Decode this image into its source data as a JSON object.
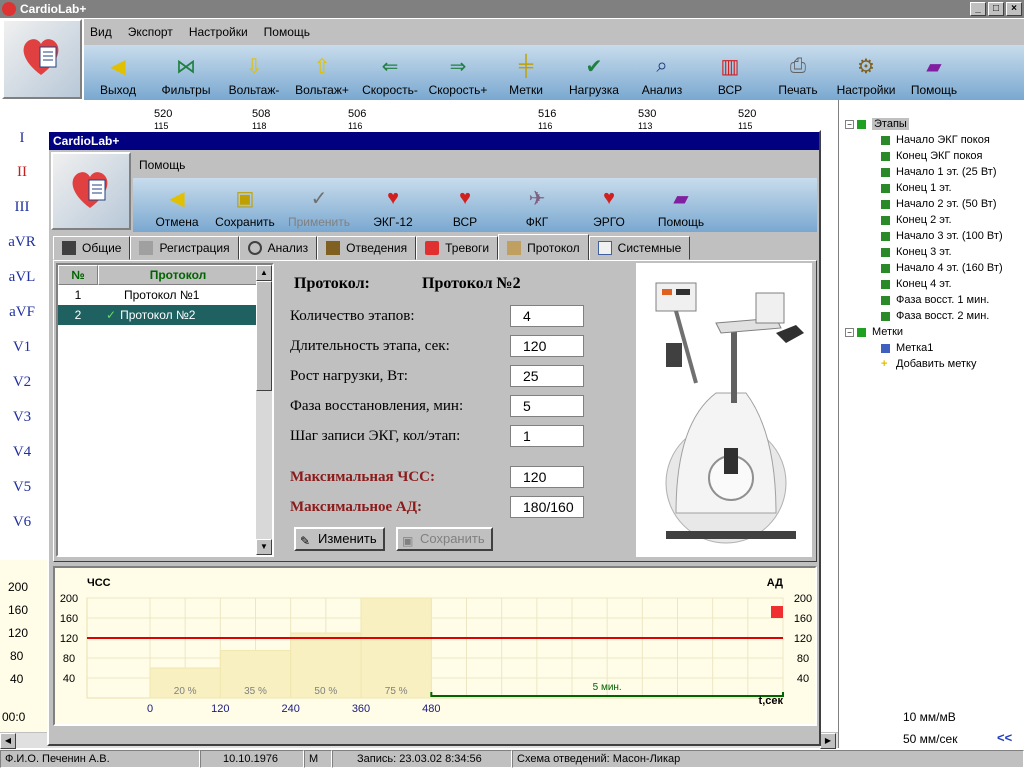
{
  "main": {
    "title": "CardioLab+",
    "menu": [
      "Вид",
      "Экспорт",
      "Настройки",
      "Помощь"
    ],
    "toolbar": [
      "Выход",
      "Фильтры",
      "Вольтаж-",
      "Вольтаж+",
      "Скорость-",
      "Скорость+",
      "Метки",
      "Нагрузка",
      "Анализ",
      "ВСР",
      "Печать",
      "Настройки",
      "Помощь"
    ],
    "leads": [
      "I",
      "II",
      "III",
      "aVR",
      "aVL",
      "aVF",
      "V1",
      "V2",
      "V3",
      "V4",
      "V5",
      "V6"
    ],
    "scale_values": [
      "520",
      "508",
      "506",
      "516",
      "530",
      "520"
    ],
    "scale_values_2": [
      "115",
      "118",
      "116",
      "116",
      "113",
      "115"
    ],
    "bottom_left": {
      "axis": [
        "200",
        "160",
        "120",
        "80",
        "40"
      ],
      "time": "00:0"
    },
    "speed_labels": {
      "voltage": "10 мм/мВ",
      "speed": "50 мм/сек",
      "arrows": "<<"
    }
  },
  "tree": {
    "root1": "Этапы",
    "stages": [
      "Начало ЭКГ покоя",
      "Конец ЭКГ покоя",
      "Начало 1 эт. (25 Вт)",
      "Конец 1 эт.",
      "Начало 2 эт. (50 Вт)",
      "Конец 2 эт.",
      "Начало 3 эт. (100 Вт)",
      "Конец 3 эт.",
      "Начало 4 эт. (160 Вт)",
      "Конец 4 эт.",
      "Фаза восст. 1 мин.",
      "Фаза восст. 2 мин."
    ],
    "root2": "Метки",
    "marks": [
      "Метка1",
      "Добавить метку"
    ]
  },
  "status": {
    "name": "Ф.И.О. Печенин А.В.",
    "dob": "10.10.1976",
    "sex": "М",
    "record": "Запись: 23.03.02 8:34:56",
    "scheme": "Схема отведений: Масон-Ликар"
  },
  "dialog": {
    "title": "CardioLab+",
    "menu": "Помощь",
    "toolbar": [
      "Отмена",
      "Сохранить",
      "Применить",
      "ЭКГ-12",
      "ВСР",
      "ФКГ",
      "ЭРГО",
      "Помощь"
    ],
    "tabs": [
      "Общие",
      "Регистрация",
      "Анализ",
      "Отведения",
      "Тревоги",
      "Протокол",
      "Системные"
    ],
    "list": {
      "headers": [
        "№",
        "Протокол"
      ],
      "rows": [
        [
          "1",
          "Протокол №1"
        ],
        [
          "2",
          "Протокол №2"
        ]
      ]
    },
    "form": {
      "protocol_label": "Протокол:",
      "protocol_value": "Протокол №2",
      "fields": [
        {
          "label": "Количество этапов:",
          "value": "4"
        },
        {
          "label": "Длительность этапа, сек:",
          "value": "120"
        },
        {
          "label": "Рост нагрузки, Вт:",
          "value": "25"
        },
        {
          "label": "Фаза восстановления, мин:",
          "value": "5"
        },
        {
          "label": "Шаг записи ЭКГ, кол/этап:",
          "value": "1"
        }
      ],
      "max_hr_label": "Максимальная ЧСС:",
      "max_hr_value": "120",
      "max_bp_label": "Максимальное АД:",
      "max_bp_value": "180/160",
      "edit_button": "Изменить",
      "save_button": "Сохранить"
    }
  },
  "chart_data": {
    "type": "bar",
    "ylabel_left": "ЧСС",
    "ylabel_right": "АД",
    "xlabel": "t,сек",
    "y_ticks": [
      "200",
      "160",
      "120",
      "80",
      "40"
    ],
    "x_ticks": [
      "0",
      "120",
      "240",
      "360",
      "480"
    ],
    "ylim": [
      0,
      200
    ],
    "xlim": [
      0,
      1080
    ],
    "stages": [
      {
        "start": 0,
        "end": 120,
        "value": 60,
        "label": "20 %"
      },
      {
        "start": 120,
        "end": 240,
        "value": 95,
        "label": "35 %"
      },
      {
        "start": 240,
        "end": 360,
        "value": 130,
        "label": "50 %"
      },
      {
        "start": 360,
        "end": 480,
        "value": 200,
        "label": "75 %"
      }
    ],
    "threshold": 120,
    "recovery": {
      "start": 480,
      "end": 1080,
      "label": "5 мин."
    },
    "colors": {
      "bars": "#f8f0c0",
      "threshold": "#e00000",
      "recovery": "#006400"
    }
  }
}
